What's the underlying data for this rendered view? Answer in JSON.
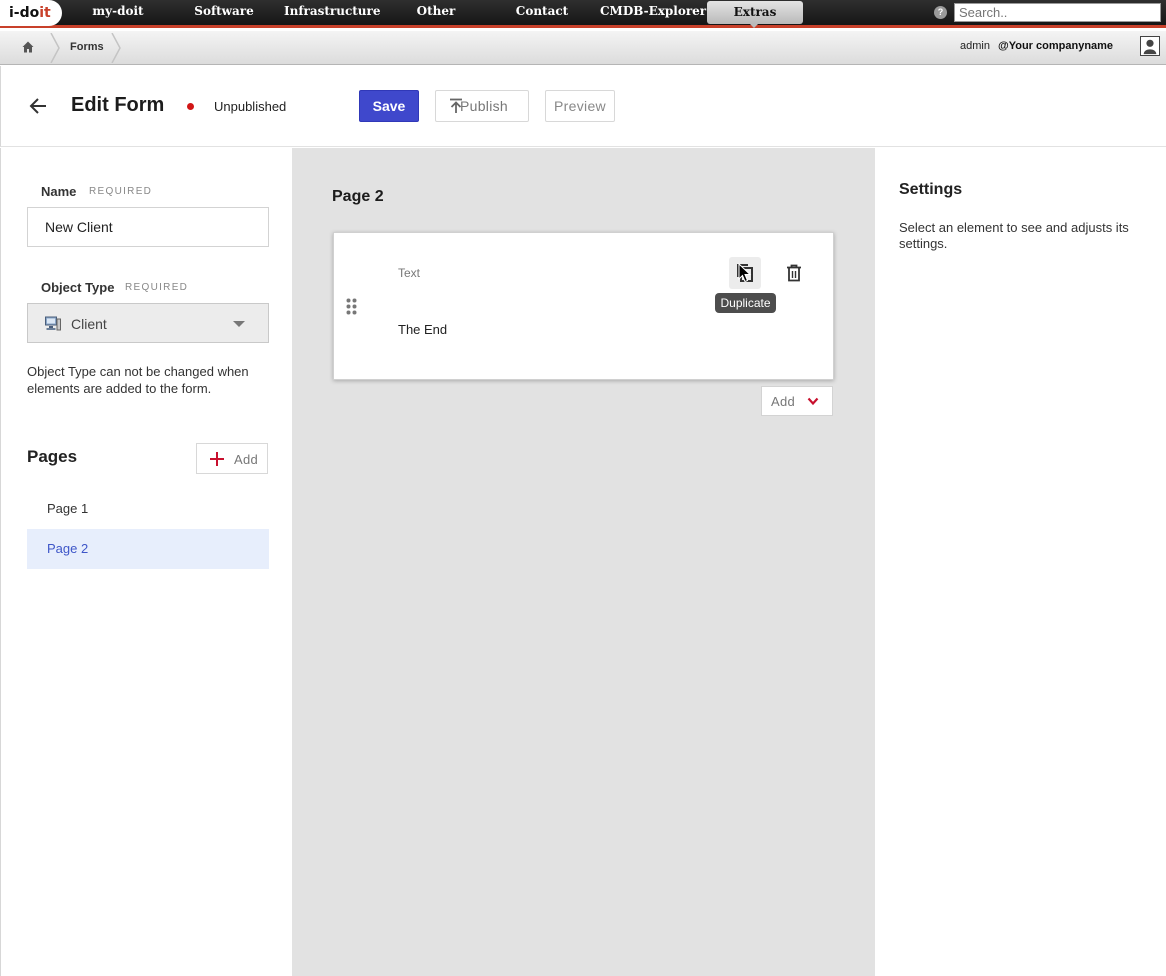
{
  "topnav": {
    "logo_main": "i-do",
    "logo_accent": "it",
    "items": [
      "my-doit",
      "Software",
      "Infrastructure",
      "Other",
      "Contact",
      "CMDB-Explorer",
      "Extras"
    ],
    "active_item": "Extras",
    "search_placeholder": "Search..",
    "help_glyph": "?"
  },
  "breadcrumb": {
    "home_icon": "home-icon",
    "current": "Forms",
    "user": "admin",
    "company": "@Your companyname"
  },
  "header": {
    "title": "Edit Form",
    "status": "Unpublished",
    "status_color": "#d11616",
    "save_label": "Save",
    "publish_label": "Publish",
    "preview_label": "Preview",
    "accent_color": "#3f48cc"
  },
  "left": {
    "name_label": "Name",
    "name_required": "REQUIRED",
    "name_value": "New Client",
    "object_type_label": "Object Type",
    "object_type_required": "REQUIRED",
    "object_type_value": "Client",
    "hint": "Object Type can not be changed when elements are added to the form.",
    "pages_title": "Pages",
    "add_label": "Add",
    "pages": [
      "Page 1",
      "Page 2"
    ],
    "selected_page": "Page 2"
  },
  "canvas": {
    "page_title": "Page 2",
    "element": {
      "type_label": "Text",
      "value": "The End"
    },
    "tooltip": "Duplicate",
    "add_label": "Add"
  },
  "settings": {
    "title": "Settings",
    "text": "Select an element to see and adjusts its settings."
  }
}
